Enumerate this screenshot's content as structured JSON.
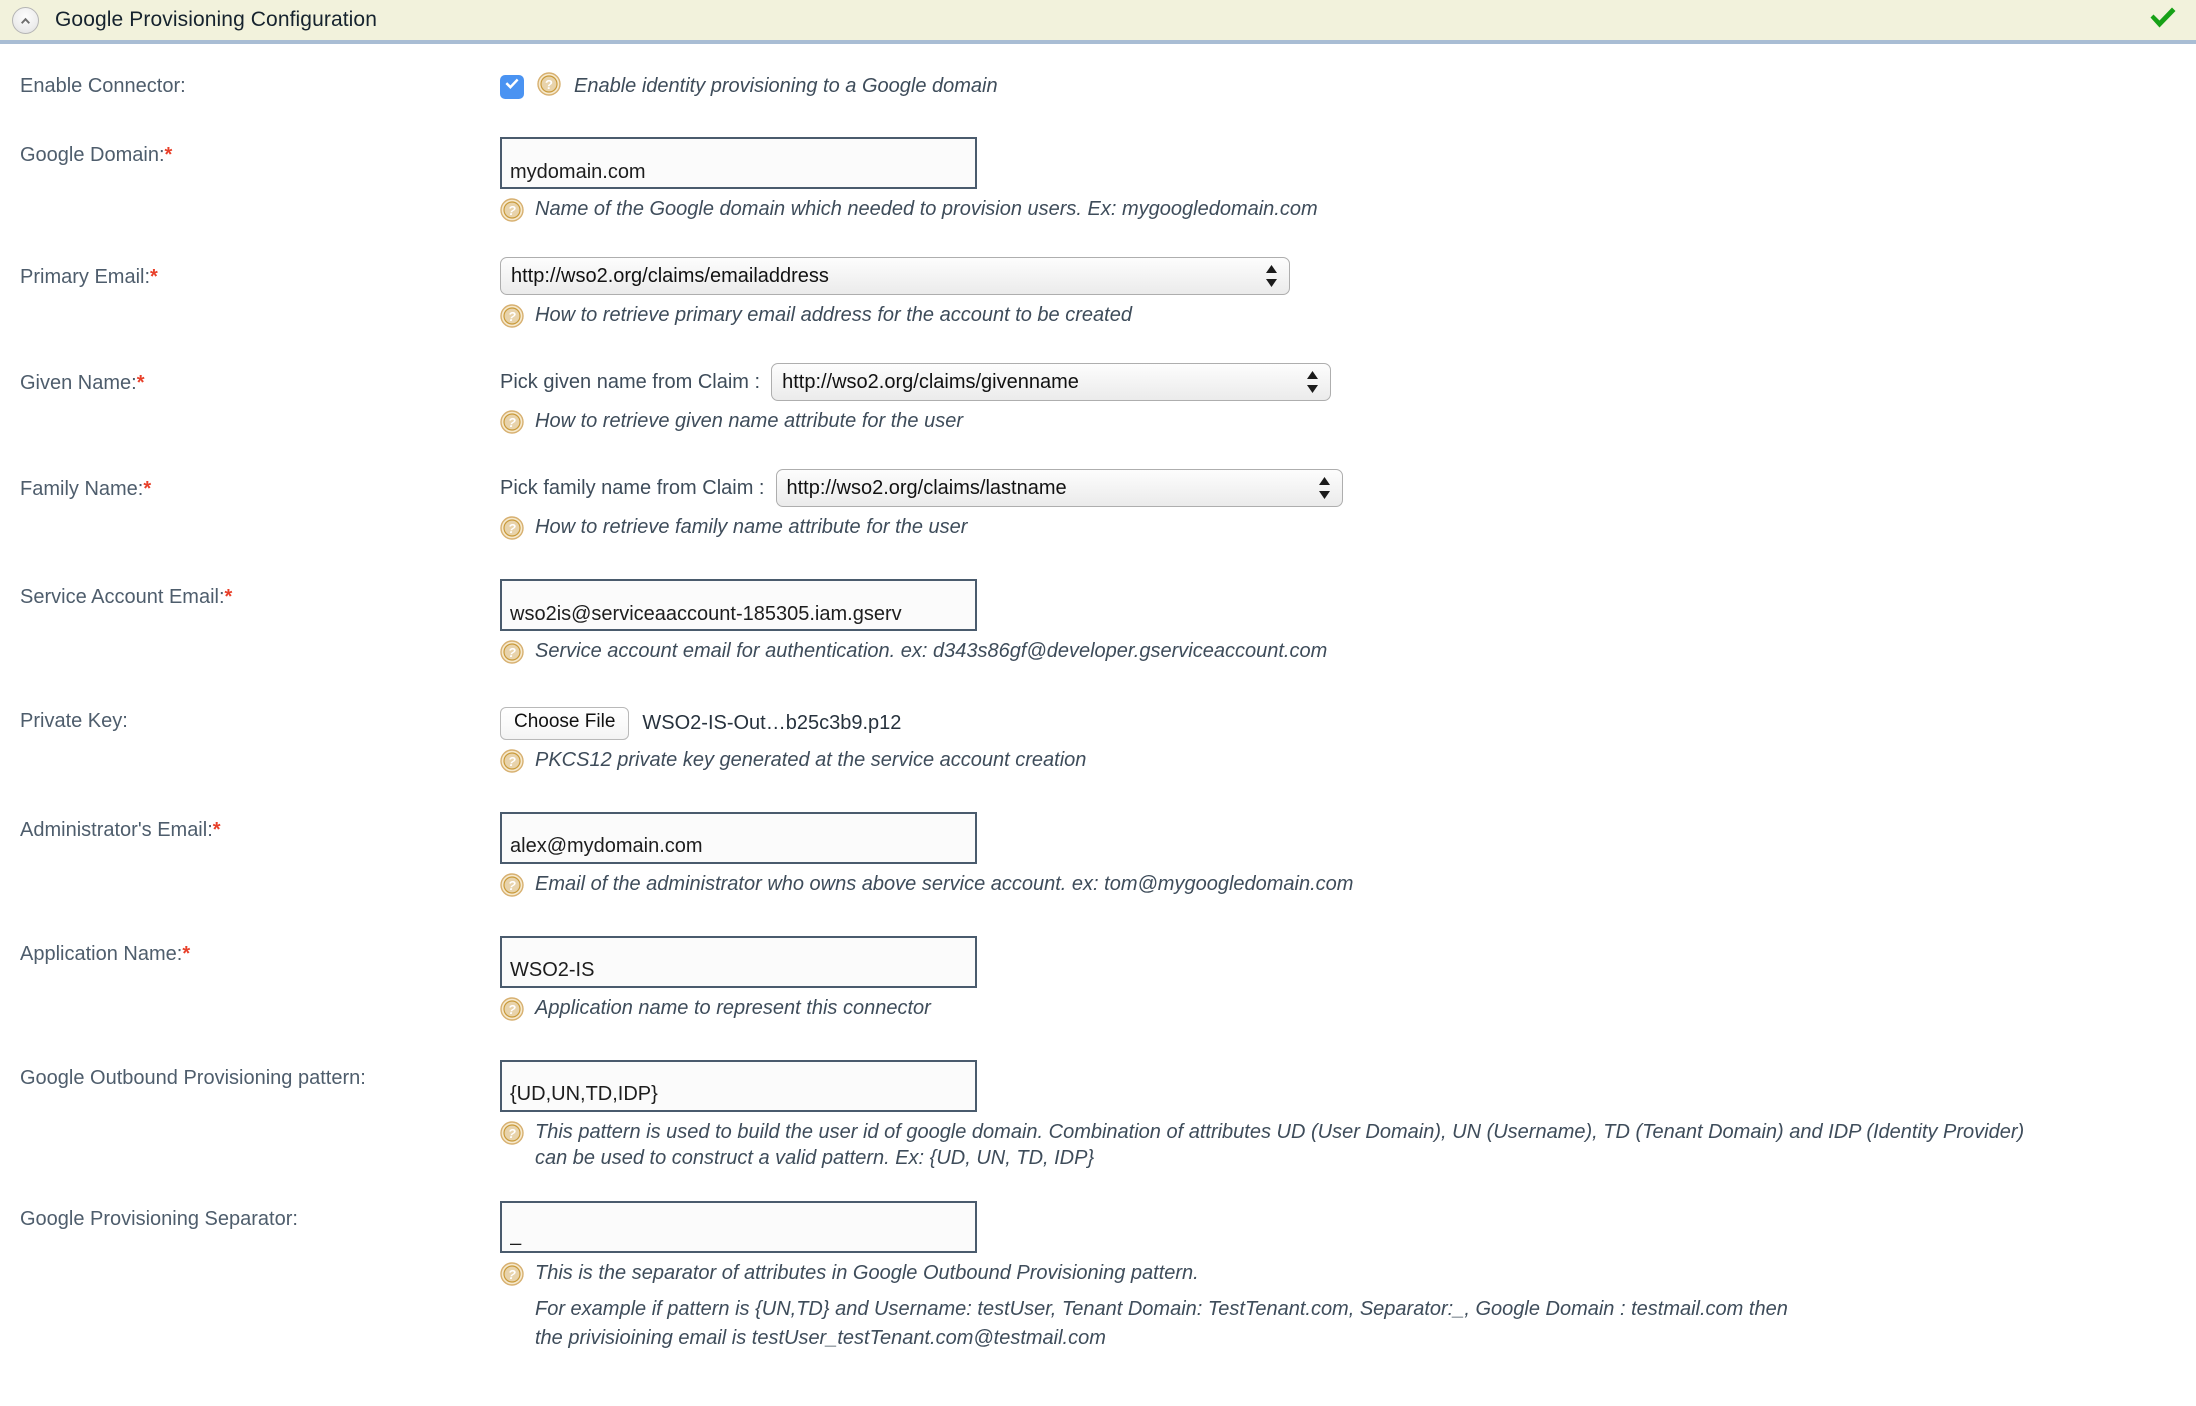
{
  "header": {
    "title": "Google Provisioning Configuration",
    "collapse_icon": "chevron-up-icon",
    "status_icon": "green-check-icon",
    "bg_color": "#f2f2dc",
    "border_color": "#a9bdd4",
    "status_color": "#1da51d"
  },
  "icons": {
    "help": "help-question-icon",
    "help_color": "#c99a3a"
  },
  "fields": {
    "enable_connector": {
      "label": "Enable Connector:",
      "checked": true,
      "checkbox_label": "Enable identity provisioning to a Google domain",
      "accent_color": "#4a93f2"
    },
    "google_domain": {
      "label": "Google Domain:",
      "required": true,
      "value": "mydomain.com",
      "hint": "Name of the Google domain which needed to provision users. Ex: mygoogledomain.com"
    },
    "primary_email": {
      "label": "Primary Email:",
      "required": true,
      "value": "http://wso2.org/claims/emailaddress",
      "options": [
        "http://wso2.org/claims/emailaddress"
      ],
      "hint": "How to retrieve primary email address for the account to be created"
    },
    "given_name": {
      "label": "Given Name:",
      "required": true,
      "claim_label": "Pick given name from Claim :",
      "value": "http://wso2.org/claims/givenname",
      "options": [
        "http://wso2.org/claims/givenname"
      ],
      "hint": "How to retrieve given name attribute for the user"
    },
    "family_name": {
      "label": "Family Name:",
      "required": true,
      "claim_label": "Pick family name from Claim :",
      "value": "http://wso2.org/claims/lastname",
      "options": [
        "http://wso2.org/claims/lastname"
      ],
      "hint": "How to retrieve family name attribute for the user"
    },
    "service_account_email": {
      "label": "Service Account Email:",
      "required": true,
      "value": "wso2is@serviceaaccount-185305.iam.gserv",
      "hint": "Service account email for authentication. ex: d343s86gf@developer.gserviceaccount.com"
    },
    "private_key": {
      "label": "Private Key:",
      "required": false,
      "button_label": "Choose File",
      "file_name": "WSO2-IS-Out…b25c3b9.p12",
      "hint": "PKCS12 private key generated at the service account creation"
    },
    "administrator_email": {
      "label": "Administrator's Email:",
      "required": true,
      "value": "alex@mydomain.com",
      "hint": "Email of the administrator who owns above service account. ex: tom@mygoogledomain.com"
    },
    "application_name": {
      "label": "Application Name:",
      "required": true,
      "value": "WSO2-IS",
      "hint": "Application name to represent this connector"
    },
    "outbound_pattern": {
      "label": "Google Outbound Provisioning pattern:",
      "required": false,
      "value": "{UD,UN,TD,IDP}",
      "hint": "This pattern is used to build the user id of google domain. Combination of attributes UD (User Domain), UN (Username), TD (Tenant Domain) and IDP (Identity Provider) can be used to construct a valid pattern. Ex: {UD, UN, TD, IDP}"
    },
    "provisioning_separator": {
      "label": "Google Provisioning Separator:",
      "required": false,
      "value": "_",
      "hint": "This is the separator of attributes in Google Outbound Provisioning pattern.",
      "hint_line2": "For example if pattern is {UN,TD} and Username: testUser, Tenant Domain: TestTenant.com, Separator:_, Google Domain : testmail.com then",
      "hint_line3": "the privisioining email is testUser_testTenant.com@testmail.com"
    }
  }
}
